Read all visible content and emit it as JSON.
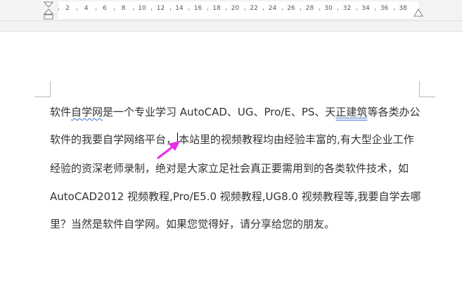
{
  "ruler": {
    "labels": [
      "2",
      "4",
      "6",
      "8",
      "10",
      "12",
      "14",
      "16",
      "18",
      "20",
      "22",
      "24",
      "26",
      "28",
      "30",
      "32",
      "34",
      "36",
      "38"
    ]
  },
  "document": {
    "line1": {
      "a": "软件",
      "b": "自学网",
      "c": "是一个专业学习 AutoCAD、UG、Pro/E、PS、天",
      "d": "正建筑",
      "e": "等各类办公"
    },
    "line2": {
      "before_caret": "软件的我要自学网络平台，",
      "after_caret": "本站里的视频教程均由经验丰富的,有大型企业工作"
    },
    "line3": "经验的资深老师录制，绝对是大家立足社会真正要需用到的各类软件技术，如",
    "line4": "AutoCAD2012 视频教程,Pro/E5.0 视频教程,UG8.0 视频教程等,我要自学去哪",
    "line5": "里？当然是软件自学网。如果您觉得好，请分享给您的朋友。"
  },
  "annotation": {
    "arrow_color": "#e62ee6"
  }
}
